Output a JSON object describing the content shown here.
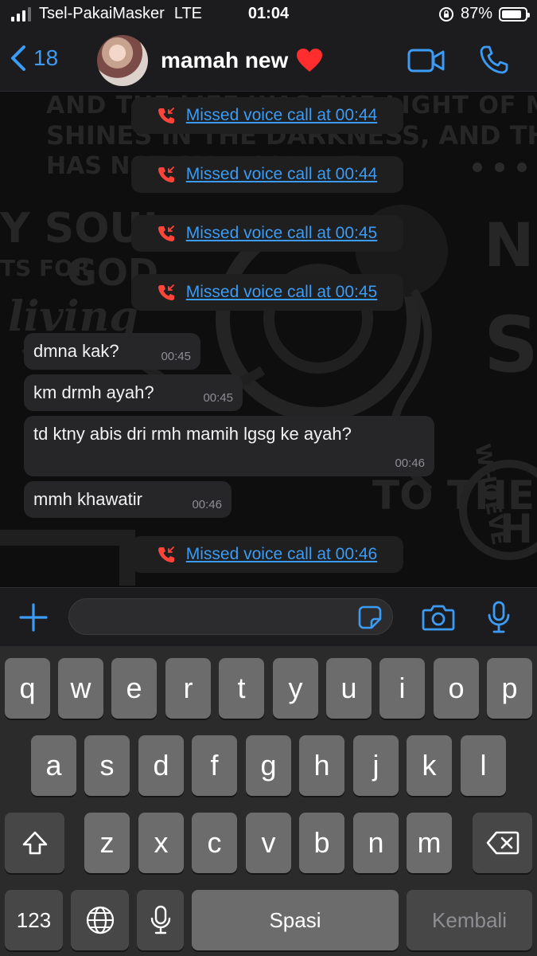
{
  "status_bar": {
    "carrier": "Tsel-PakaiMasker",
    "network": "LTE",
    "time": "01:04",
    "battery": "87%",
    "battery_level": 0.87
  },
  "nav": {
    "back_count": "18",
    "contact_name": "mamah new",
    "heart": "❤️"
  },
  "messages": {
    "calls": [
      {
        "text": "Missed voice call at 00:44"
      },
      {
        "text": "Missed voice call at 00:44"
      },
      {
        "text": "Missed voice call at 00:45"
      },
      {
        "text": "Missed voice call at 00:45"
      },
      {
        "text": "Missed voice call at 00:46"
      }
    ],
    "bubbles": [
      {
        "text": "dmna kak?",
        "time": "00:45"
      },
      {
        "text": "km drmh ayah?",
        "time": "00:45"
      },
      {
        "text": "td ktny abis dri rmh mamih lgsg ke ayah?",
        "time": "00:46"
      },
      {
        "text": "mmh khawatir",
        "time": "00:46"
      }
    ]
  },
  "wallpaper_text": [
    "AND THE LIFE WAS THE LIGHT OF MEN. THE L",
    "SHINES IN THE DARKNESS, AND THE DARK",
    "HAS NOT OVERCOME IT",
    "Y SOUL",
    "TS FOR",
    "GOD",
    "living",
    "NO",
    "S",
    "TO THE",
    "WHOEVE",
    "H"
  ],
  "keyboard": {
    "row1": [
      "q",
      "w",
      "e",
      "r",
      "t",
      "y",
      "u",
      "i",
      "o",
      "p"
    ],
    "row2": [
      "a",
      "s",
      "d",
      "f",
      "g",
      "h",
      "j",
      "k",
      "l"
    ],
    "row3": [
      "z",
      "x",
      "c",
      "v",
      "b",
      "n",
      "m"
    ],
    "numbers": "123",
    "space": "Spasi",
    "return": "Kembali"
  },
  "colors": {
    "accent": "#3b9bf5",
    "missed_call": "#ff453a",
    "bubble": "#262628",
    "bar": "#1c1c1e"
  }
}
